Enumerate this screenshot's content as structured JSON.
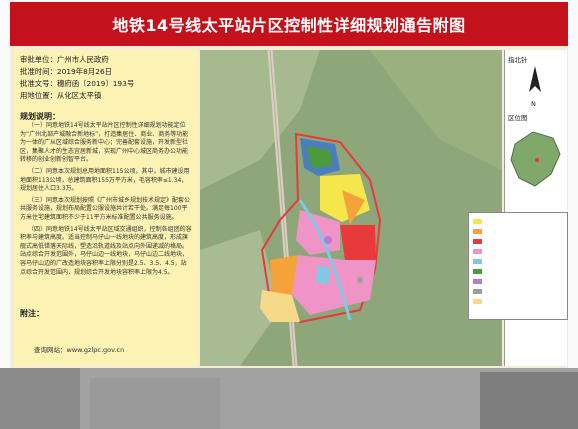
{
  "header": {
    "title": "地铁14号线太平站片区控制性详细规划通告附图"
  },
  "meta": {
    "authority": "审批单位：广州市人民政府",
    "date": "批准时间：2019年8月26日",
    "doc": "批准文号：穗府函〔2019〕193号",
    "location": "用地位置：从化区太平镇"
  },
  "explanation": {
    "title": "规划说明：",
    "paragraphs": [
      "（一）同意地铁14号线太平站片区控制性详细规划功能定位为“广州北部产城融合新地标”，打造集居住、商业、商务等功能为一体的广从区域综合服务新中心；完善配套设施，开发新型社区，集聚人才的生态宜居新城，实现广州中心城区商务办公功能转移的创业创新创智平台。",
      "（二）同意本次规划总用地面积115公顷。其中，城市建设用地面积113公顷，总建筑面积155万平方米，毛容积率≤1.34，规划居住人口3.3万。",
      "（三）同意本次规划按照《广州市城乡规划技术规定》配套公共服务设施，规划布局配置公服设施共计若干处。满足每100平方米住宅建筑面积不少于11平方米标准配置公共服务设施。",
      "（四）同意地铁14号线太平站区域交通组织，控制各组团的容积率与建筑高度。适当控制马仔山一线地块的建筑高度，形成旗舰式高低错落天际线，塑造沿轨道线及站点向外围递减的格局。站点综合开发范围外，马仔山边一线地块，马仔山边二线地块，容马仔山边的广改造地块容积率上限分别是2.5、3.5、4.5，站点综合开发范围内，规划综合开发地块容积率上限为4.5。"
    ]
  },
  "footer": {
    "note_label": "附注：",
    "query": "查询网站：www.gzlpc.gov.cn"
  },
  "right_panel": {
    "compass_label": "N",
    "scale_label": "指北针",
    "location_label": "区位图"
  },
  "legend": {
    "colors": [
      "#f5e64d",
      "#f6a23a",
      "#e8393c",
      "#f093c6",
      "#7ec9e3",
      "#4b9a3e",
      "#b57bd6",
      "#9c9c9c",
      "#f7d98a"
    ]
  }
}
